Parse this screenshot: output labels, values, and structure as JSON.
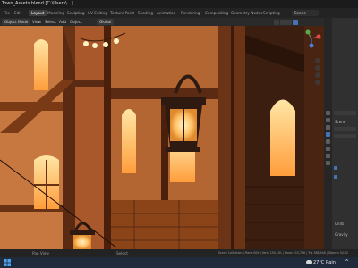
{
  "window": {
    "title": "Town_Assets.blend [C:\\Users\\...]"
  },
  "workspaces": {
    "tabs": [
      "File",
      "Edit",
      "Render",
      "Window",
      "Help",
      "Layout",
      "Modeling",
      "Sculpting",
      "UV Editing",
      "Texture Paint",
      "Shading",
      "Animation",
      "Rendering",
      "Compositing",
      "Geometry Nodes",
      "Scripting"
    ],
    "active": "Layout"
  },
  "scene": {
    "label": "Scene"
  },
  "viewport_header": {
    "mode": "Object Mode",
    "menus": [
      "View",
      "Select",
      "Add",
      "Object"
    ],
    "transform_orientation": "Global",
    "shading_active": "rendered"
  },
  "properties": {
    "panels": [
      "Scene",
      "Units",
      "Gravity"
    ]
  },
  "statusbar": {
    "left": "Pan View",
    "middle": "Select",
    "stats": "Scene Collection | Plane.009 | Verts 250,161 | Faces 215,786 | Tris 388,948 | Objects 0/182"
  },
  "taskbar": {
    "weather": "27°C  Rain",
    "tray": "^"
  },
  "colors": {
    "accent": "#4772b3",
    "glow": "#ffc36a",
    "wood_dark": "#5a2a12",
    "wood_light": "#c9763a"
  },
  "icons": [
    "blender-icon",
    "windows-logo-icon",
    "cloud-rain-icon",
    "gizmo-x-icon",
    "gizmo-y-icon",
    "gizmo-z-icon",
    "zoom-icon",
    "hand-icon",
    "camera-icon",
    "grid-icon"
  ]
}
